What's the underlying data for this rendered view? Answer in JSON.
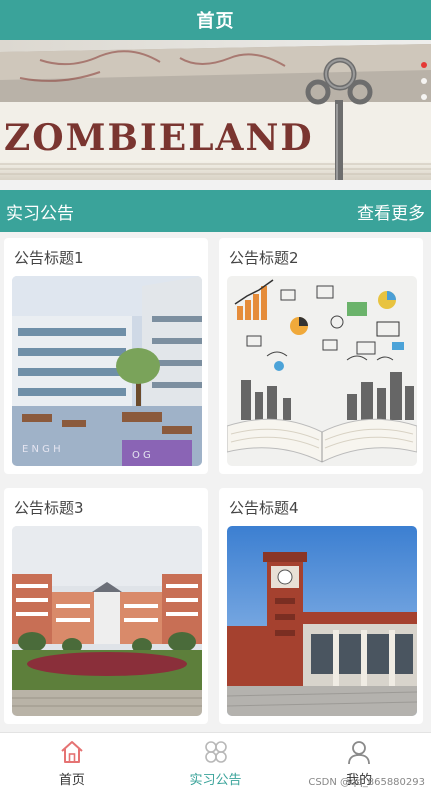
{
  "header": {
    "title": "首页"
  },
  "banner": {
    "book_text": "ZOMBIELAND",
    "dots": 3,
    "active_dot": 0
  },
  "section": {
    "title": "实习公告",
    "more_label": "查看更多"
  },
  "notices": [
    {
      "title": "公告标题1",
      "image": "campus-courtyard"
    },
    {
      "title": "公告标题2",
      "image": "open-book-data"
    },
    {
      "title": "公告标题3",
      "image": "campus-building-garden"
    },
    {
      "title": "公告标题4",
      "image": "clock-tower-building"
    }
  ],
  "tabbar": {
    "items": [
      {
        "label": "首页",
        "icon": "home-icon"
      },
      {
        "label": "实习公告",
        "icon": "grid-icon"
      },
      {
        "label": "我的",
        "icon": "user-icon"
      }
    ]
  },
  "watermark": {
    "text": "CSDN @qq_865880293"
  },
  "colors": {
    "accent": "#3aa39a",
    "home_icon": "#e57373",
    "active_dot": "#e53935"
  }
}
